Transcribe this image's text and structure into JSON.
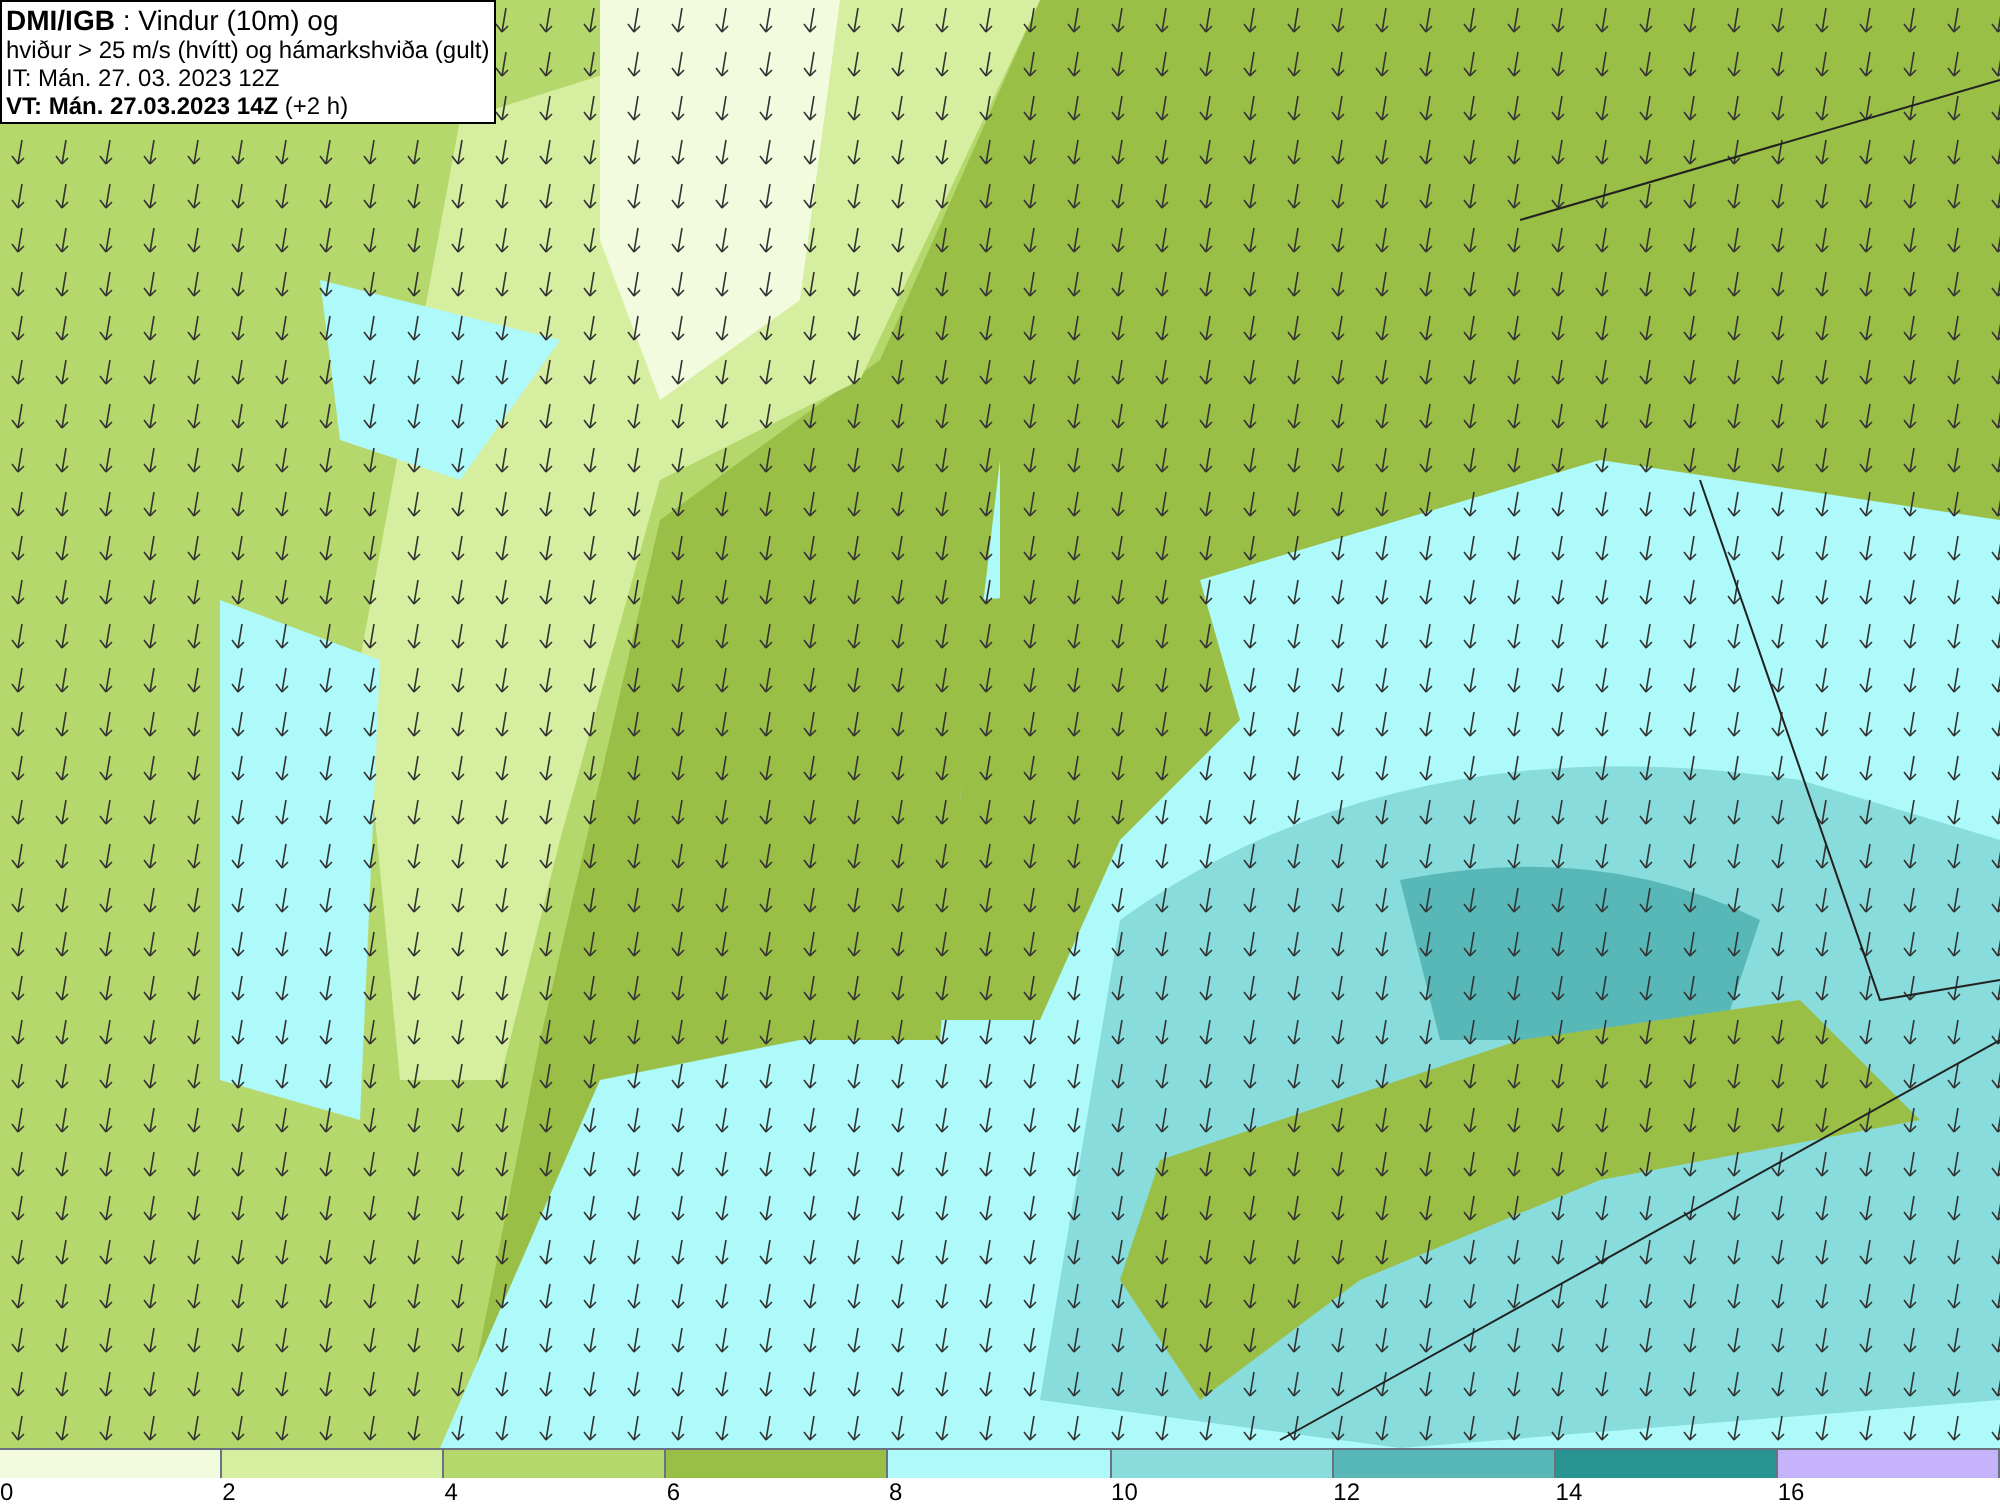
{
  "info_box": {
    "lines": [
      "**DMI/IGB** : Vindur (10m) og",
      "hviður > 25 m/s (hvítt) og hámarkshviða (gult)",
      "IT: Mán. 27. 03. 2023 12Z",
      "**VT: Mán. 27.03.2023 14Z** (+2 h)"
    ]
  },
  "legend": {
    "bins": [
      {
        "color": "#f3fbdf"
      },
      {
        "color": "#d6eea0"
      },
      {
        "color": "#b5d86c"
      },
      {
        "color": "#9abf46"
      },
      {
        "color": "#aef9fa"
      },
      {
        "color": "#88dcdc"
      },
      {
        "color": "#58b8b8"
      },
      {
        "color": "#279491"
      },
      {
        "color": "#c5b3fb"
      }
    ],
    "ticks": [
      "0",
      "2",
      "4",
      "6",
      "8",
      "10",
      "12",
      "14",
      "16"
    ]
  }
}
